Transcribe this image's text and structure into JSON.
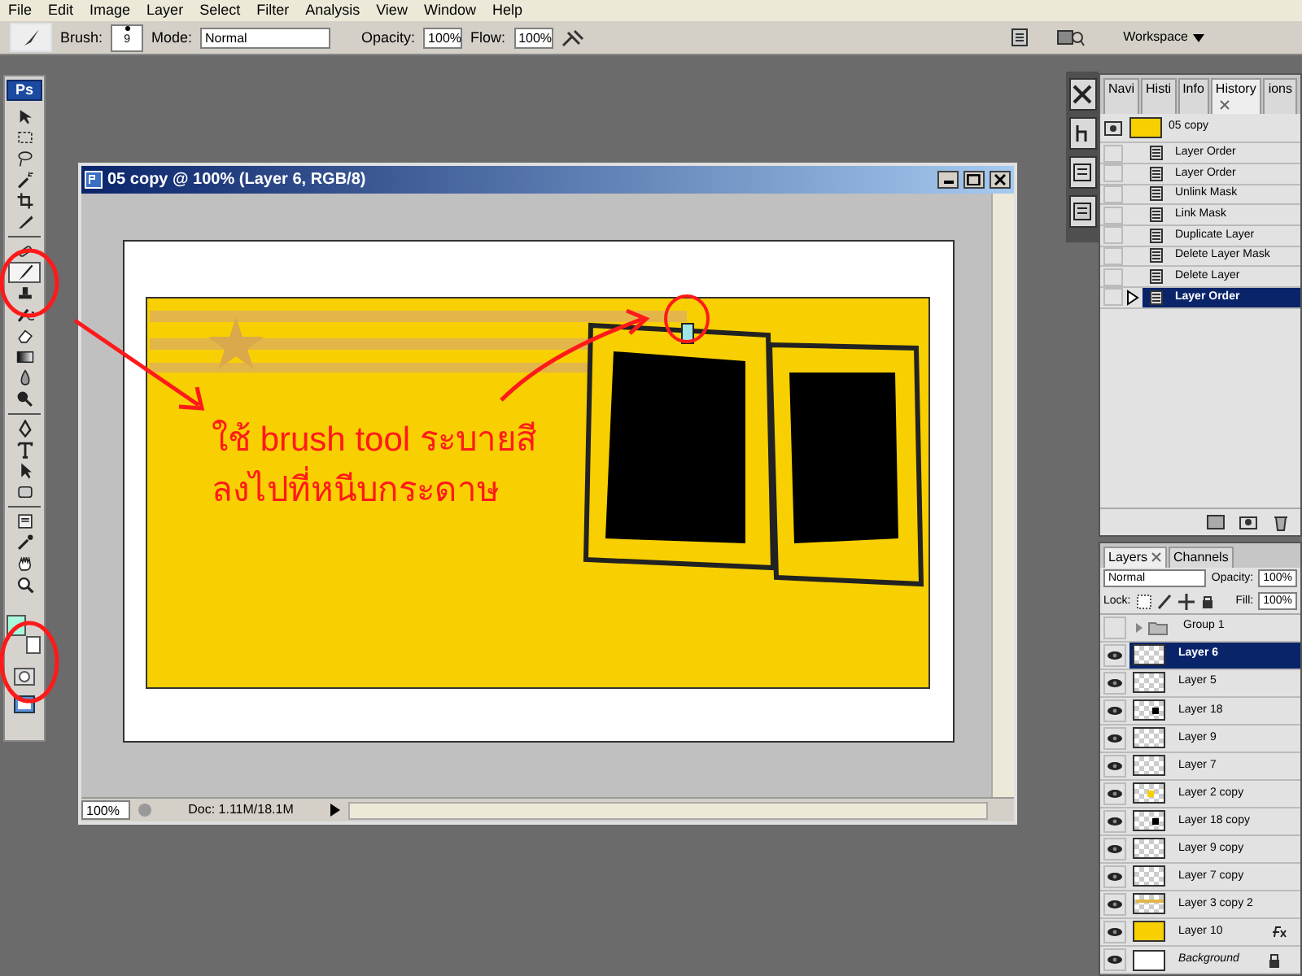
{
  "menu_bar": {
    "items": [
      "File",
      "Edit",
      "Image",
      "Layer",
      "Select",
      "Filter",
      "Analysis",
      "View",
      "Window",
      "Help"
    ]
  },
  "options_bar": {
    "brush_label": "Brush:",
    "brush_size": "9",
    "mode_label": "Mode:",
    "mode": "Normal",
    "opacity_label": "Opacity:",
    "opacity": "100%",
    "flow_label": "Flow:",
    "flow": "100%",
    "workspace": "Workspace"
  },
  "toolbox": {
    "logo": "Ps",
    "tools": [
      {
        "kind": "move",
        "selected": false
      },
      {
        "kind": "marquee",
        "selected": false
      },
      {
        "kind": "lasso",
        "selected": false
      },
      {
        "kind": "wand",
        "selected": false
      },
      {
        "kind": "crop",
        "selected": false
      },
      {
        "kind": "slice",
        "selected": false
      },
      {
        "kind": "heal",
        "selected": false
      },
      {
        "kind": "brush",
        "selected": true
      },
      {
        "kind": "stamp",
        "selected": false
      },
      {
        "kind": "history",
        "selected": false
      },
      {
        "kind": "eraser",
        "selected": false
      },
      {
        "kind": "gradient",
        "selected": false
      },
      {
        "kind": "blur",
        "selected": false
      },
      {
        "kind": "dodge",
        "selected": false
      },
      {
        "kind": "pen",
        "selected": false
      },
      {
        "kind": "type",
        "selected": false
      },
      {
        "kind": "select",
        "selected": false
      },
      {
        "kind": "shape",
        "selected": false
      },
      {
        "kind": "notes",
        "selected": false
      },
      {
        "kind": "eyedropper",
        "selected": false
      },
      {
        "kind": "hand",
        "selected": false
      },
      {
        "kind": "zoom",
        "selected": false
      }
    ]
  },
  "document": {
    "title": "05 copy @ 100% (Layer 6, RGB/8)",
    "annotation": [
      "ใช้ brush tool ระบายสี",
      "ลงไปที่หนีบกระดาษ"
    ],
    "zoom": "100%",
    "doc_info": "Doc: 1.11M/18.1M"
  },
  "history_panel": {
    "tabs": [
      {
        "label": "Navi",
        "selected": false
      },
      {
        "label": "Histi",
        "selected": false
      },
      {
        "label": "Info",
        "selected": false
      },
      {
        "label": "History",
        "selected": true
      },
      {
        "label": "ions",
        "selected": false
      }
    ],
    "snapshot": "05 copy",
    "items": [
      {
        "label": "Layer Order",
        "selected": false,
        "source": false
      },
      {
        "label": "Layer Order",
        "selected": false,
        "source": false
      },
      {
        "label": "Unlink Mask",
        "selected": false,
        "source": false
      },
      {
        "label": "Link Mask",
        "selected": false,
        "source": false
      },
      {
        "label": "Duplicate Layer",
        "selected": false,
        "source": false
      },
      {
        "label": "Delete Layer Mask",
        "selected": false,
        "source": false
      },
      {
        "label": "Delete Layer",
        "selected": false,
        "source": false
      },
      {
        "label": "Layer Order",
        "selected": true,
        "source": false
      }
    ]
  },
  "layers_panel": {
    "tabs": [
      {
        "label": "Layers",
        "selected": true
      },
      {
        "label": "Channels",
        "selected": false
      }
    ],
    "blend_mode": "Normal",
    "opacity_label": "Opacity:",
    "opacity": "100%",
    "lock_label": "Lock:",
    "fill_label": "Fill:",
    "fill": "100%",
    "layers": [
      {
        "name": "Group 1",
        "kind": "group",
        "visible": false,
        "selected": false,
        "effects": false
      },
      {
        "name": "Layer 6",
        "kind": "empty",
        "visible": true,
        "selected": true,
        "effects": false
      },
      {
        "name": "Layer 5",
        "kind": "empty",
        "visible": true,
        "selected": false,
        "effects": false
      },
      {
        "name": "Layer 18",
        "kind": "dot",
        "visible": true,
        "selected": false,
        "effects": false
      },
      {
        "name": "Layer 9",
        "kind": "empty",
        "visible": true,
        "selected": false,
        "effects": false
      },
      {
        "name": "Layer 7",
        "kind": "empty",
        "visible": true,
        "selected": false,
        "effects": false
      },
      {
        "name": "Layer 2 copy",
        "kind": "yellow-dot",
        "visible": true,
        "selected": false,
        "effects": false
      },
      {
        "name": "Layer 18 copy",
        "kind": "dot",
        "visible": true,
        "selected": false,
        "effects": false
      },
      {
        "name": "Layer 9 copy",
        "kind": "empty",
        "visible": true,
        "selected": false,
        "effects": false
      },
      {
        "name": "Layer 7 copy",
        "kind": "empty",
        "visible": true,
        "selected": false,
        "effects": false
      },
      {
        "name": "Layer 3 copy 2",
        "kind": "stripe",
        "visible": true,
        "selected": false,
        "effects": false
      },
      {
        "name": "Layer 10",
        "kind": "fill",
        "visible": true,
        "selected": false,
        "effects": true
      },
      {
        "name": "Background",
        "kind": "background",
        "visible": true,
        "selected": false,
        "effects": false
      }
    ]
  }
}
